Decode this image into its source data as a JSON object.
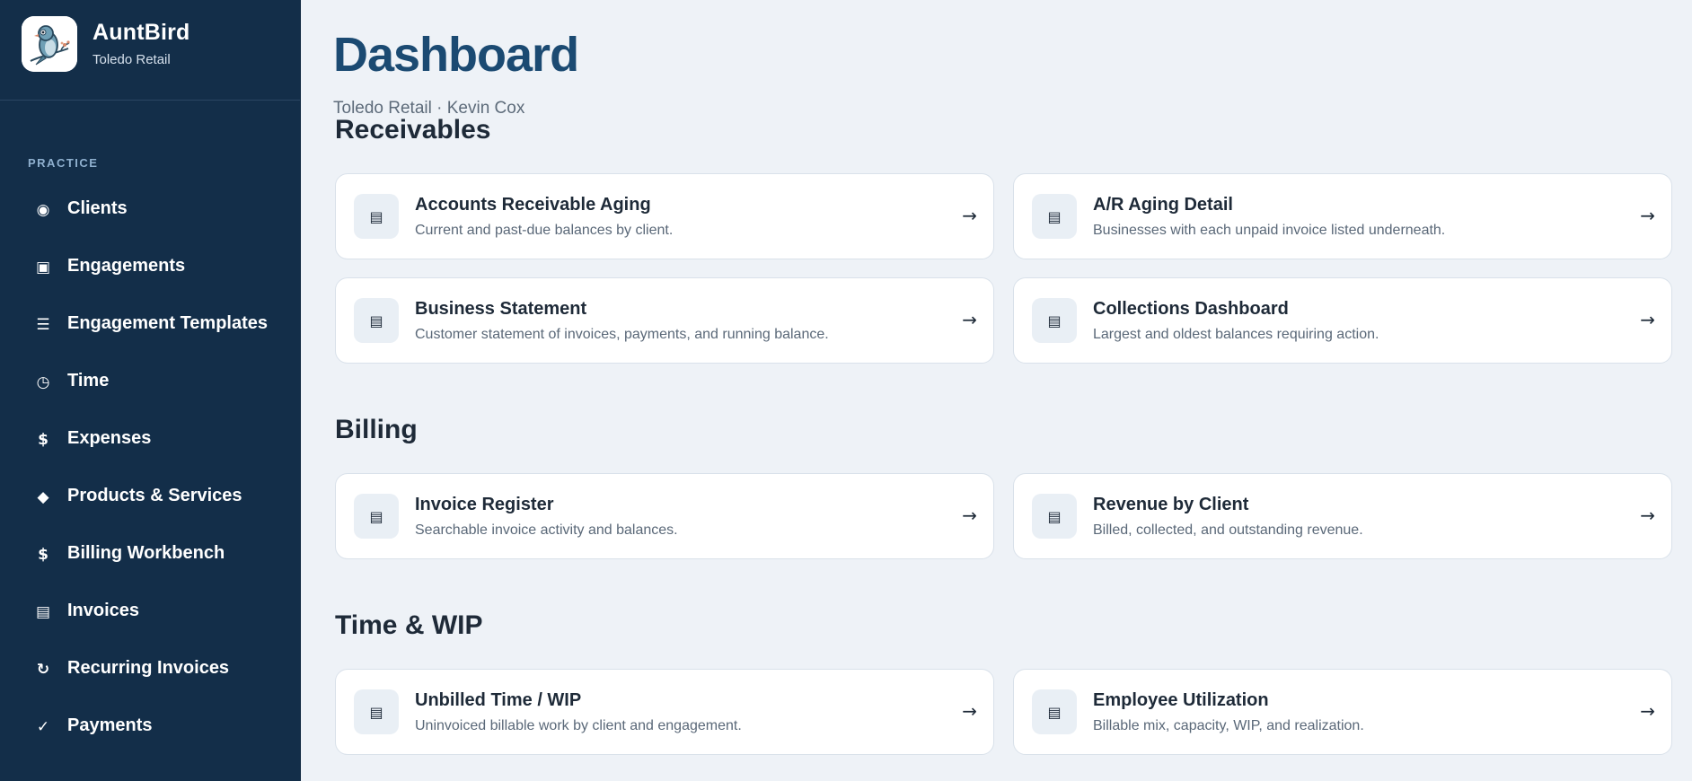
{
  "brand": {
    "name": "AuntBird",
    "subtitle": "Toledo Retail"
  },
  "sidebar": {
    "section": "PRACTICE",
    "items": [
      {
        "label": "Clients",
        "icon": "◉",
        "icon_name": "clients-icon"
      },
      {
        "label": "Engagements",
        "icon": "▣",
        "icon_name": "engagements-icon"
      },
      {
        "label": "Engagement Templates",
        "icon": "☰",
        "icon_name": "templates-icon"
      },
      {
        "label": "Time",
        "icon": "◷",
        "icon_name": "clock-icon"
      },
      {
        "label": "Expenses",
        "icon": "$",
        "icon_name": "dollar-icon"
      },
      {
        "label": "Products & Services",
        "icon": "◆",
        "icon_name": "diamond-icon"
      },
      {
        "label": "Billing Workbench",
        "icon": "$",
        "icon_name": "dollar-icon"
      },
      {
        "label": "Invoices",
        "icon": "▤",
        "icon_name": "invoice-icon"
      },
      {
        "label": "Recurring Invoices",
        "icon": "↻",
        "icon_name": "recurring-icon"
      },
      {
        "label": "Payments",
        "icon": "✓",
        "icon_name": "check-icon"
      }
    ]
  },
  "page": {
    "title": "Dashboard",
    "subtitle": "Toledo Retail · Kevin Cox"
  },
  "sections": [
    {
      "title": "Receivables",
      "cards": [
        {
          "title": "Accounts Receivable Aging",
          "desc": "Current and past-due balances by client.",
          "icon": "▤",
          "arrow": "→"
        },
        {
          "title": "A/R Aging Detail",
          "desc": "Businesses with each unpaid invoice listed underneath.",
          "icon": "▤",
          "arrow": "→"
        },
        {
          "title": "Business Statement",
          "desc": "Customer statement of invoices, payments, and running balance.",
          "icon": "▤",
          "arrow": "→"
        },
        {
          "title": "Collections Dashboard",
          "desc": "Largest and oldest balances requiring action.",
          "icon": "▤",
          "arrow": "→"
        }
      ]
    },
    {
      "title": "Billing",
      "cards": [
        {
          "title": "Invoice Register",
          "desc": "Searchable invoice activity and balances.",
          "icon": "▤",
          "arrow": "→"
        },
        {
          "title": "Revenue by Client",
          "desc": "Billed, collected, and outstanding revenue.",
          "icon": "▤",
          "arrow": "→"
        }
      ]
    },
    {
      "title": "Time & WIP",
      "cards": [
        {
          "title": "Unbilled Time / WIP",
          "desc": "Uninvoiced billable work by client and engagement.",
          "icon": "▤",
          "arrow": "→"
        },
        {
          "title": "Employee Utilization",
          "desc": "Billable mix, capacity, WIP, and realization.",
          "icon": "▤",
          "arrow": "→"
        }
      ]
    }
  ],
  "colors": {
    "sidebar_bg": "#132e49",
    "page_bg": "#eef2f7",
    "title": "#1b4a72",
    "section_label": "#8fb0cf"
  }
}
